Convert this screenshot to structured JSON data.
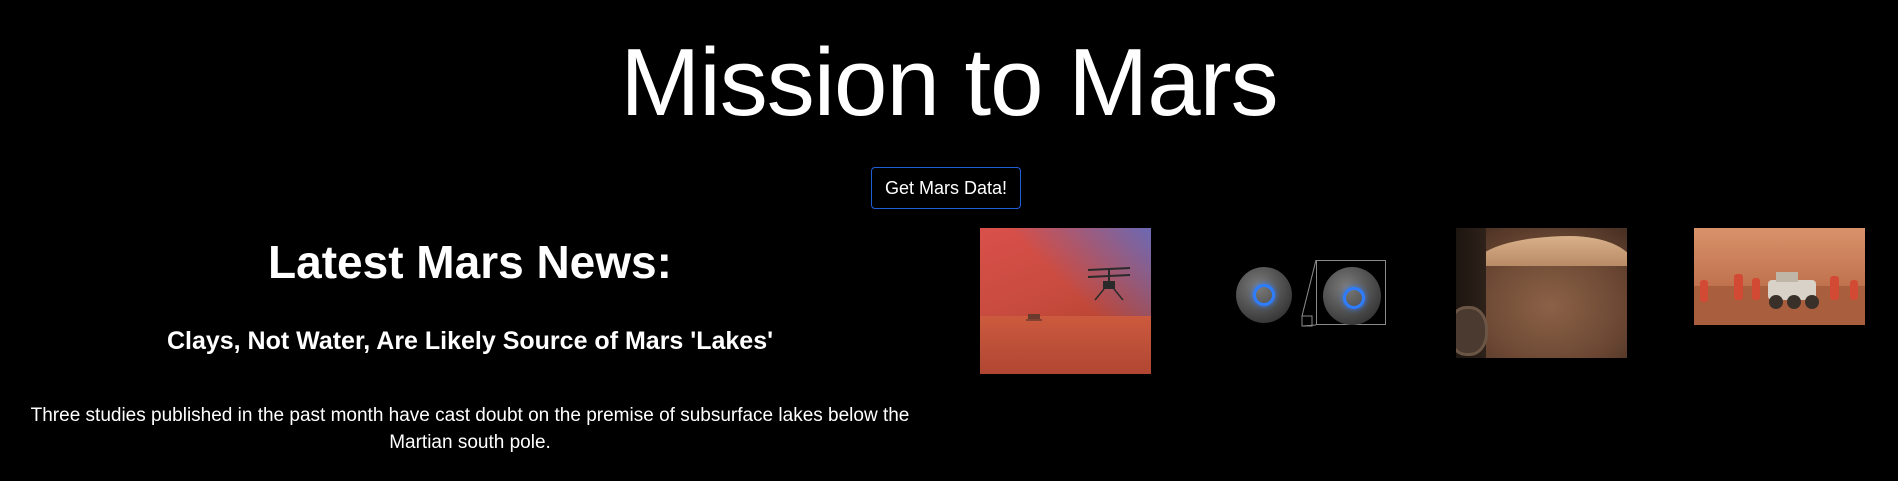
{
  "header": {
    "title": "Mission to Mars"
  },
  "actions": {
    "get_data_label": "Get Mars Data!"
  },
  "news": {
    "heading": "Latest Mars News:",
    "title": "Clays, Not Water, Are Likely Source of Mars 'Lakes'",
    "paragraph": "Three studies published in the past month have cast doubt on the premise of subsurface lakes below the Martian south pole."
  },
  "images": [
    {
      "name": "helicopter-image"
    },
    {
      "name": "globes-image"
    },
    {
      "name": "terrain-image"
    },
    {
      "name": "rover-image"
    }
  ],
  "colors": {
    "background": "#000000",
    "text": "#ffffff",
    "button_border": "#1f5fd6"
  }
}
